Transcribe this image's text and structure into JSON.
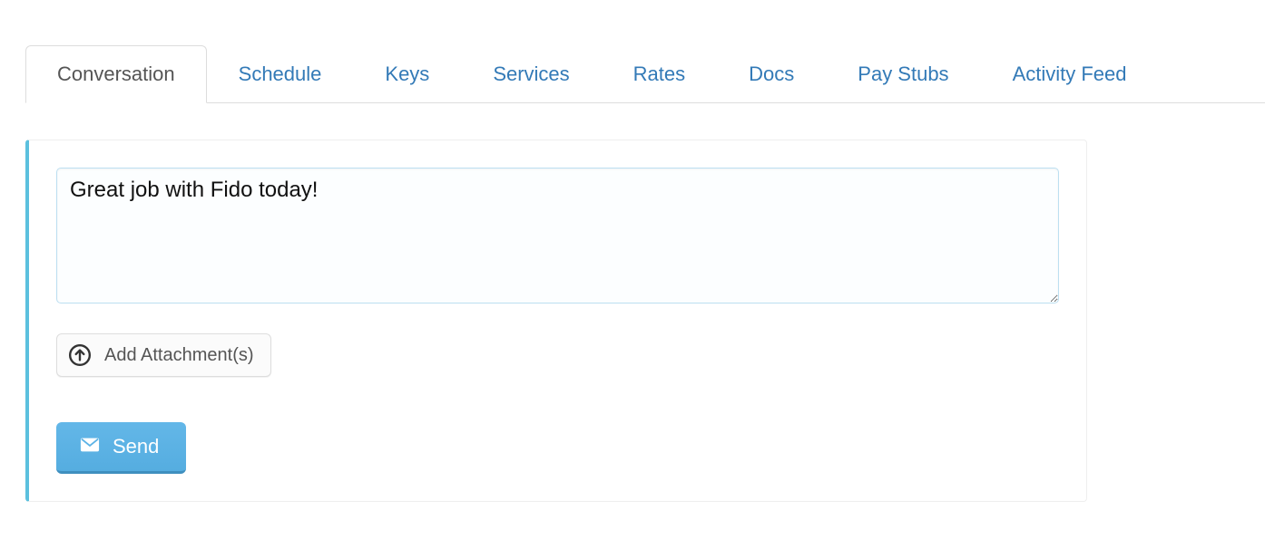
{
  "tabs": {
    "items": [
      {
        "label": "Conversation",
        "active": true
      },
      {
        "label": "Schedule",
        "active": false
      },
      {
        "label": "Keys",
        "active": false
      },
      {
        "label": "Services",
        "active": false
      },
      {
        "label": "Rates",
        "active": false
      },
      {
        "label": "Docs",
        "active": false
      },
      {
        "label": "Pay Stubs",
        "active": false
      },
      {
        "label": "Activity Feed",
        "active": false
      }
    ]
  },
  "compose": {
    "message_value": "Great job with Fido today!",
    "attach_label": "Add Attachment(s)",
    "send_label": "Send"
  },
  "colors": {
    "accent_blue": "#337ab7",
    "info_border": "#5bc0de",
    "send_bg": "#5cb3e6"
  }
}
